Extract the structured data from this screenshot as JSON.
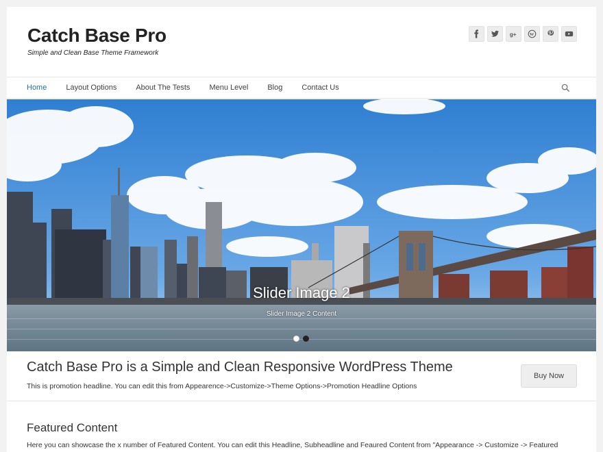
{
  "header": {
    "site_title": "Catch Base Pro",
    "site_description": "Simple and Clean Base Theme Framework",
    "social_icons": [
      "facebook-icon",
      "twitter-icon",
      "googleplus-icon",
      "wordpress-icon",
      "pinterest-icon",
      "youtube-icon"
    ]
  },
  "nav": {
    "items": [
      {
        "label": "Home",
        "active": true
      },
      {
        "label": "Layout Options"
      },
      {
        "label": "About The Tests"
      },
      {
        "label": "Menu Level"
      },
      {
        "label": "Blog"
      },
      {
        "label": "Contact Us"
      }
    ],
    "search_icon": "search-icon"
  },
  "slider": {
    "title": "Slider Image 2",
    "content": "Slider Image 2 Content",
    "slide_count": 2,
    "active_slide": 2
  },
  "promotion": {
    "headline": "Catch Base Pro is a Simple and Clean Responsive WordPress Theme",
    "subheadline": "This is promotion headline. You can edit this from Appearence->Customize->Theme Options->Promotion Headline Options",
    "button_label": "Buy Now"
  },
  "featured": {
    "title": "Featured Content",
    "description": "Here you can showcase the x number of Featured Content. You can edit this Headline, Subheadline and Feaured Content from \"Appearance -> Customize -> Featured"
  },
  "colors": {
    "accent": "#21759b",
    "sky": "#3f8ad6",
    "water": "#6d8596"
  }
}
